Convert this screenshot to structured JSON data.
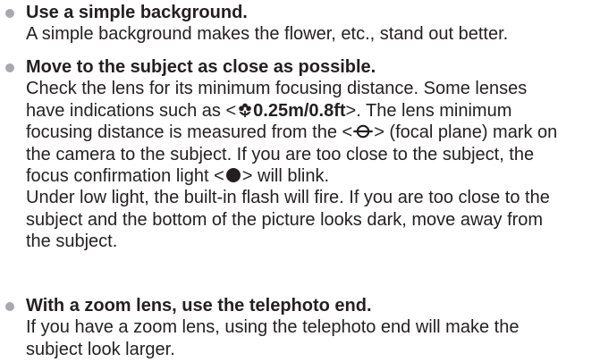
{
  "tips": [
    {
      "heading": "Use a simple background.",
      "lines": [
        "A simple background makes the flower, etc., stand out better."
      ]
    },
    {
      "heading": "Move to the subject as close as possible.",
      "lines": [
        "Check the lens for its minimum focusing distance. Some lenses",
        "the camera to the subject. If you are too close to the subject, the",
        "Under low light, the built-in flash will fire. If you are too close to the",
        "subject and the bottom of the picture looks dark, move away from",
        "the subject."
      ],
      "line2_prefix": "have indications such as <",
      "line2_bold": "0.25m/0.8ft",
      "line2_suffix": ">. The lens minimum",
      "line3_prefix": "focusing distance is measured from the <",
      "line3_suffix": "> (focal plane) mark on",
      "line5_prefix": "focus confirmation light <",
      "line5_suffix": "> will blink."
    },
    {
      "heading": "With a zoom lens, use the telephoto end.",
      "lines": [
        "If you have a zoom lens, using the telephoto end will make the",
        "subject look larger."
      ]
    }
  ],
  "icons": {
    "bullet_color": "#a7a9ac",
    "macro": "flower-macro-icon",
    "focal_plane": "focal-plane-mark-icon",
    "focus_confirmation": "focus-confirmation-light-icon"
  }
}
